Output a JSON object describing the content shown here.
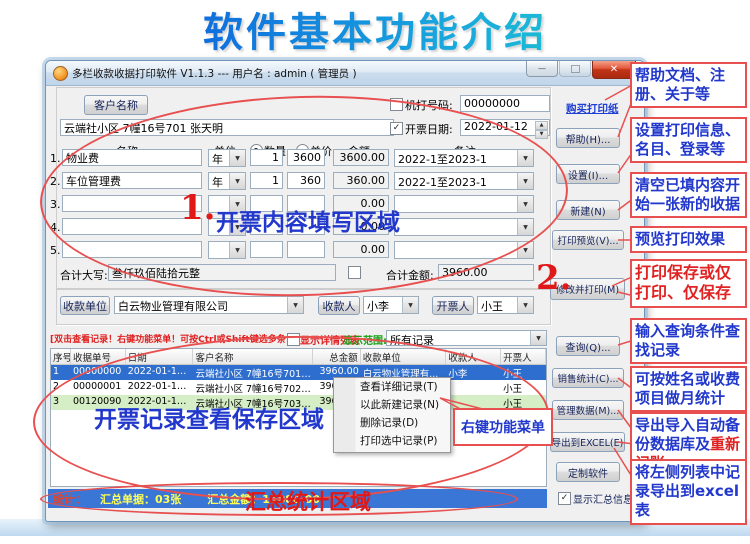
{
  "slide": {
    "title": "软件基本功能介绍"
  },
  "window": {
    "title": "多栏收款收据打印软件 V1.1.3 --- 用户名 : admin ( 管理员 )",
    "buy_paper_link": "购买打印纸"
  },
  "icons": {
    "dropdown": "▼",
    "check": "✓",
    "minimize": "—",
    "close": "✕",
    "spin_up": "▲",
    "spin_down": "▼"
  },
  "form": {
    "customer_button": "客户名称",
    "customer_value": "云端社小区 7幢16号701 张天明",
    "machine_no_label": "机打号码:",
    "machine_no_value": "00000000",
    "date_label": "开票日期:",
    "date_value": "2022-01-12",
    "columns": {
      "name": "名称",
      "unit": "单位",
      "qty": "数量",
      "price": "单价",
      "amount": "金额",
      "remark": "备注"
    },
    "items": [
      {
        "no": "1.",
        "name": "物业费",
        "unit": "年",
        "qty": "1",
        "price": "3600",
        "amount": "3600.00",
        "remark": "2022-1至2023-1"
      },
      {
        "no": "2.",
        "name": "车位管理费",
        "unit": "年",
        "qty": "1",
        "price": "360",
        "amount": "360.00",
        "remark": "2022-1至2023-1"
      },
      {
        "no": "3.",
        "name": "",
        "unit": "",
        "qty": "",
        "price": "",
        "amount": "0.00",
        "remark": ""
      },
      {
        "no": "4.",
        "name": "",
        "unit": "",
        "qty": "",
        "price": "",
        "amount": "0.00",
        "remark": ""
      },
      {
        "no": "5.",
        "name": "",
        "unit": "",
        "qty": "",
        "price": "",
        "amount": "0.00",
        "remark": ""
      }
    ],
    "total_words_label": "合计大写:",
    "total_words_value": "叁仟玖佰陆拾元整",
    "total_amount_label": "合计金额:",
    "total_amount_value": "3960.00",
    "payee_company_button": "收款单位",
    "payee_company_value": "白云物业管理有限公司",
    "payee_button": "收款人",
    "payee_value": "小李",
    "drawer_button": "开票人",
    "drawer_value": "小王"
  },
  "records": {
    "hint": "[双击查看记录！右键功能菜单！可按Ctrl或Shift键选多条记录批量打印]",
    "detail_checkbox_label": "显示详情列表",
    "scope_label": "显示范围:",
    "scope_value": "所有记录",
    "headers": [
      "序号",
      "收据单号",
      "日期",
      "客户名称",
      "总金额",
      "收款单位",
      "收款人",
      "开票人"
    ],
    "rows": [
      [
        "1",
        "00000000",
        "2022-01-12...",
        "云端社小区 7幢16号701 ...",
        "3960.00",
        "白云物业管理有...",
        "小李",
        "小王"
      ],
      [
        "2",
        "00000001",
        "2022-01-12...",
        "云端社小区 7幢16号702 ...",
        "3960.00",
        "",
        "",
        "小王"
      ],
      [
        "3",
        "00120090",
        "2022-01-12...",
        "云端社小区 7幢16号703 ...",
        "3960.00",
        "",
        "",
        "小王"
      ]
    ]
  },
  "context_menu": {
    "items": [
      "查看详细记录(T)",
      "以此新建记录(N)",
      "删除记录(D)",
      "打印选中记录(P)"
    ]
  },
  "buttons": {
    "help": "帮助(H)...",
    "settings": "设置(I)...",
    "new_doc": "新建(N)",
    "preview": "打印预览(V)...",
    "modify_print": "修改并打印(M)",
    "query": "查询(Q)...",
    "sales_stats": "销售统计(C)...",
    "manage_data": "管理数据(M)...",
    "export_excel": "导出到EXCEL(E)",
    "custom_software": "定制软件",
    "show_summary_label": "显示汇总信息"
  },
  "statusbar": {
    "stats_label": "统计：",
    "doc_count": "汇总单据：03张",
    "total_amount": "汇总金额：11880.00"
  },
  "annotations": {
    "area1_number": "1.",
    "area1_text": "开票内容填写区域",
    "area2_number": "2.",
    "records_area_text": "开票记录查看保存区域",
    "menu_box_text": "右键功能菜单",
    "summary_area_text": "汇总统计区域",
    "right_boxes": [
      {
        "text": "帮助文档、注册、关于等"
      },
      {
        "text": "设置打印信息、名目、登录等"
      },
      {
        "text": "清空已填内容开始一张新的收据"
      },
      {
        "text": "预览打印效果"
      },
      {
        "text": "打印保存或仅打印、仅保存",
        "style": "red"
      },
      {
        "text": "输入查询条件查找记录"
      },
      {
        "text": "可按姓名或收费项目做月统计"
      },
      {
        "text": "导出导入自动备份数据库及",
        "text2": "重新记账"
      },
      {
        "text": "将左侧列表中记录导出到excel表"
      }
    ]
  },
  "colors": {
    "annotation_red": "#e85050",
    "annotation_blue": "#2238cc",
    "selected_row_blue": "#2e6ecf",
    "alt_row_green": "#d5eec5",
    "statusbar_blue": "#3a76d6",
    "statusbar_yellow": "#ffff55",
    "statusbar_red": "#e8442a",
    "title_gradient_start": "#1155e0",
    "title_gradient_end": "#22d6c8",
    "link_blue": "#1f3fd4",
    "scope_green": "#12a012"
  }
}
